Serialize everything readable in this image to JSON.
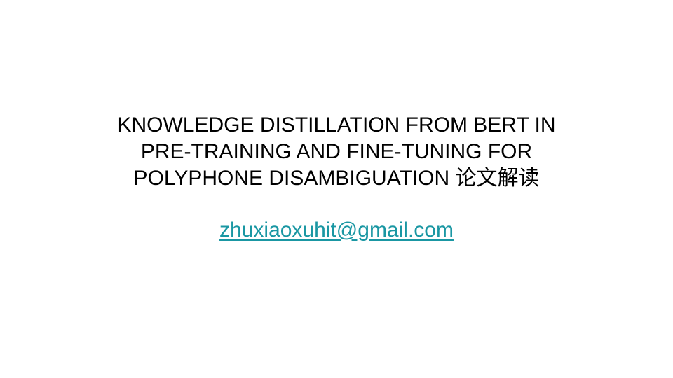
{
  "slide": {
    "title_lines": [
      "KNOWLEDGE DISTILLATION FROM BERT IN",
      "PRE-TRAINING AND FINE-TUNING FOR",
      "POLYPHONE DISAMBIGUATION 论文解读"
    ],
    "email": "zhuxiaoxuhit@gmail.com",
    "colors": {
      "background": "#ffffff",
      "title_text": "#000000",
      "link": "#1a97a3"
    }
  }
}
